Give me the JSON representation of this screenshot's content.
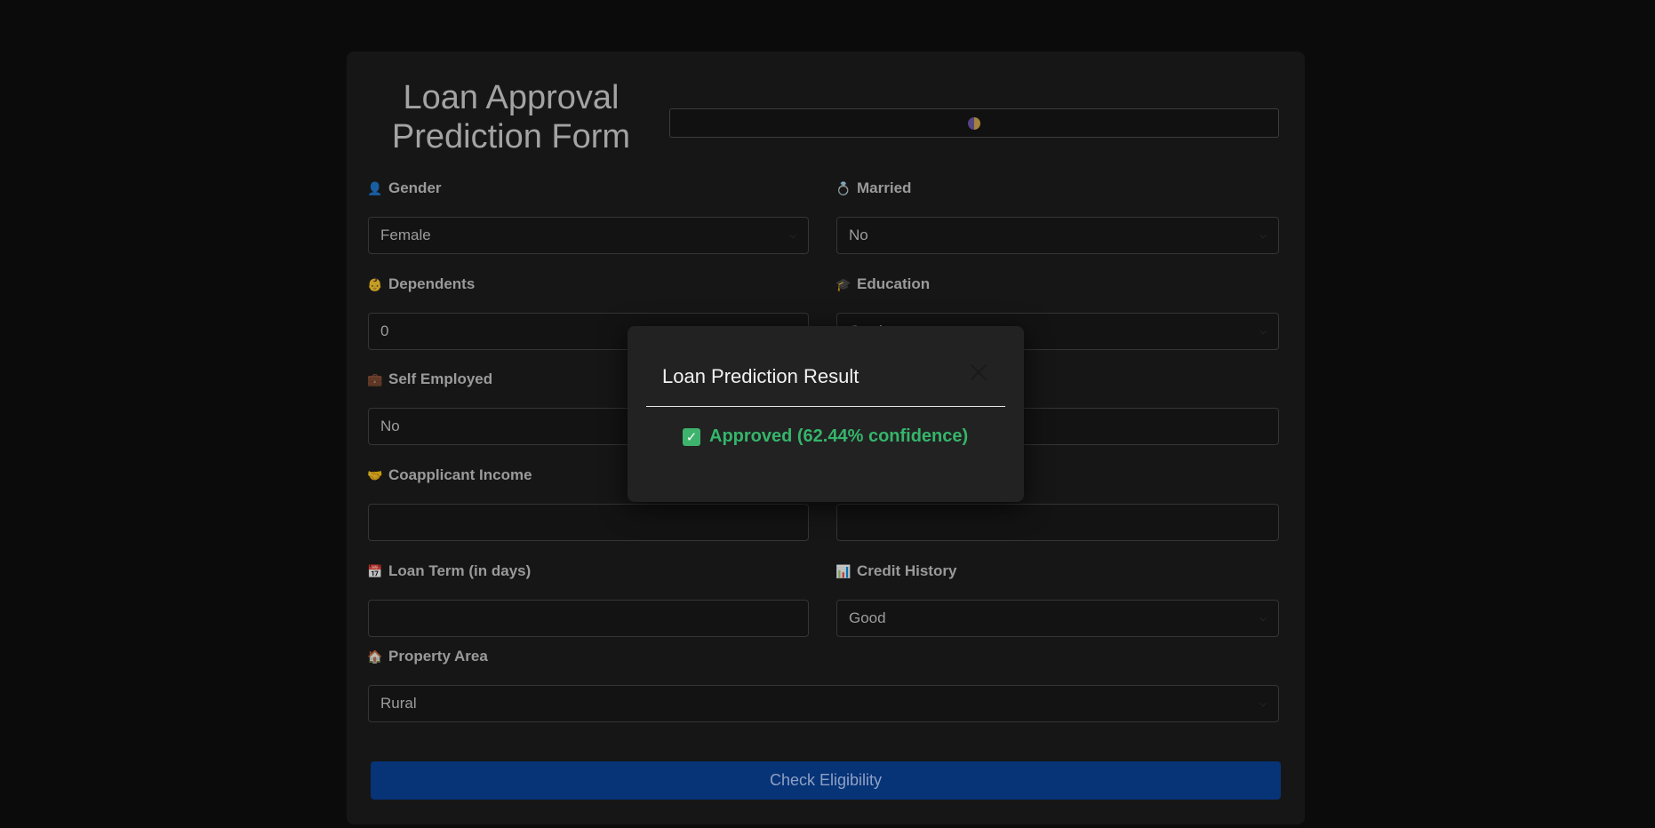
{
  "form": {
    "title_line1": "Loan Approval",
    "title_line2": "Prediction Form",
    "theme_icon": "half-moon-icon",
    "fields": {
      "gender": {
        "label": "Gender",
        "icon": "person-icon",
        "value": "Female"
      },
      "married": {
        "label": "Married",
        "icon": "ring-icon",
        "value": "No"
      },
      "dependents": {
        "label": "Dependents",
        "icon": "baby-icon",
        "value": "0"
      },
      "education": {
        "label": "Education",
        "icon": "graduation-cap-icon",
        "value": "Graduate"
      },
      "self_employed": {
        "label": "Self Employed",
        "icon": "briefcase-icon",
        "value": "No"
      },
      "applicant_income": {
        "value": ""
      },
      "coapplicant_income": {
        "label": "Coapplicant Income",
        "icon": "handshake-icon",
        "value": ""
      },
      "loan_amount": {
        "value": ""
      },
      "loan_term": {
        "label": "Loan Term (in days)",
        "icon": "calendar-icon",
        "value": ""
      },
      "credit_history": {
        "label": "Credit History",
        "icon": "bar-chart-icon",
        "value": "Good"
      },
      "property_area": {
        "label": "Property Area",
        "icon": "house-icon",
        "value": "Rural"
      }
    },
    "submit_label": "Check Eligibility"
  },
  "modal": {
    "title": "Loan Prediction Result",
    "result_text": "Approved (62.44% confidence)",
    "result_color": "#35b56b"
  }
}
